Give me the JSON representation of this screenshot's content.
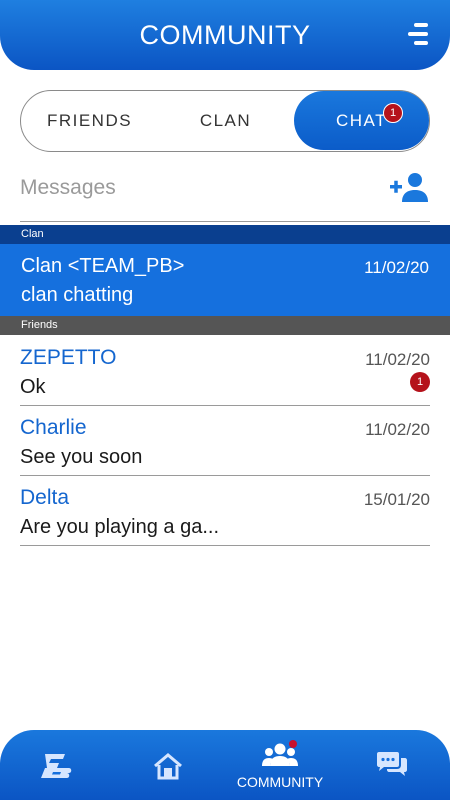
{
  "header": {
    "title": "COMMUNITY",
    "menu_icon": "menu-icon"
  },
  "tabs": [
    {
      "label": "FRIENDS",
      "active": false
    },
    {
      "label": "CLAN",
      "active": false
    },
    {
      "label": "CHAT",
      "active": true,
      "badge": "1"
    }
  ],
  "messages": {
    "title": "Messages",
    "add_icon": "add-friend-icon"
  },
  "sections": {
    "clan": "Clan",
    "friends": "Friends"
  },
  "clan_chat": {
    "name": "Clan <TEAM_PB>",
    "date": "11/02/20",
    "message": "clan chatting"
  },
  "friends": [
    {
      "name": "ZEPETTO",
      "date": "11/02/20",
      "message": "Ok",
      "unread": "1"
    },
    {
      "name": "Charlie",
      "date": "11/02/20",
      "message": "See you soon"
    },
    {
      "name": "Delta",
      "date": "15/01/20",
      "message": "Are you playing a ga..."
    }
  ],
  "nav": [
    {
      "icon": "pb-logo-icon"
    },
    {
      "icon": "home-icon"
    },
    {
      "icon": "community-icon",
      "label": "COMMUNITY",
      "active": true
    },
    {
      "icon": "chat-bubbles-icon"
    }
  ],
  "colors": {
    "primary": "#0b5cc9",
    "badge": "#b5121b",
    "clan_header": "#0a3f8f",
    "friends_header": "#555555"
  }
}
